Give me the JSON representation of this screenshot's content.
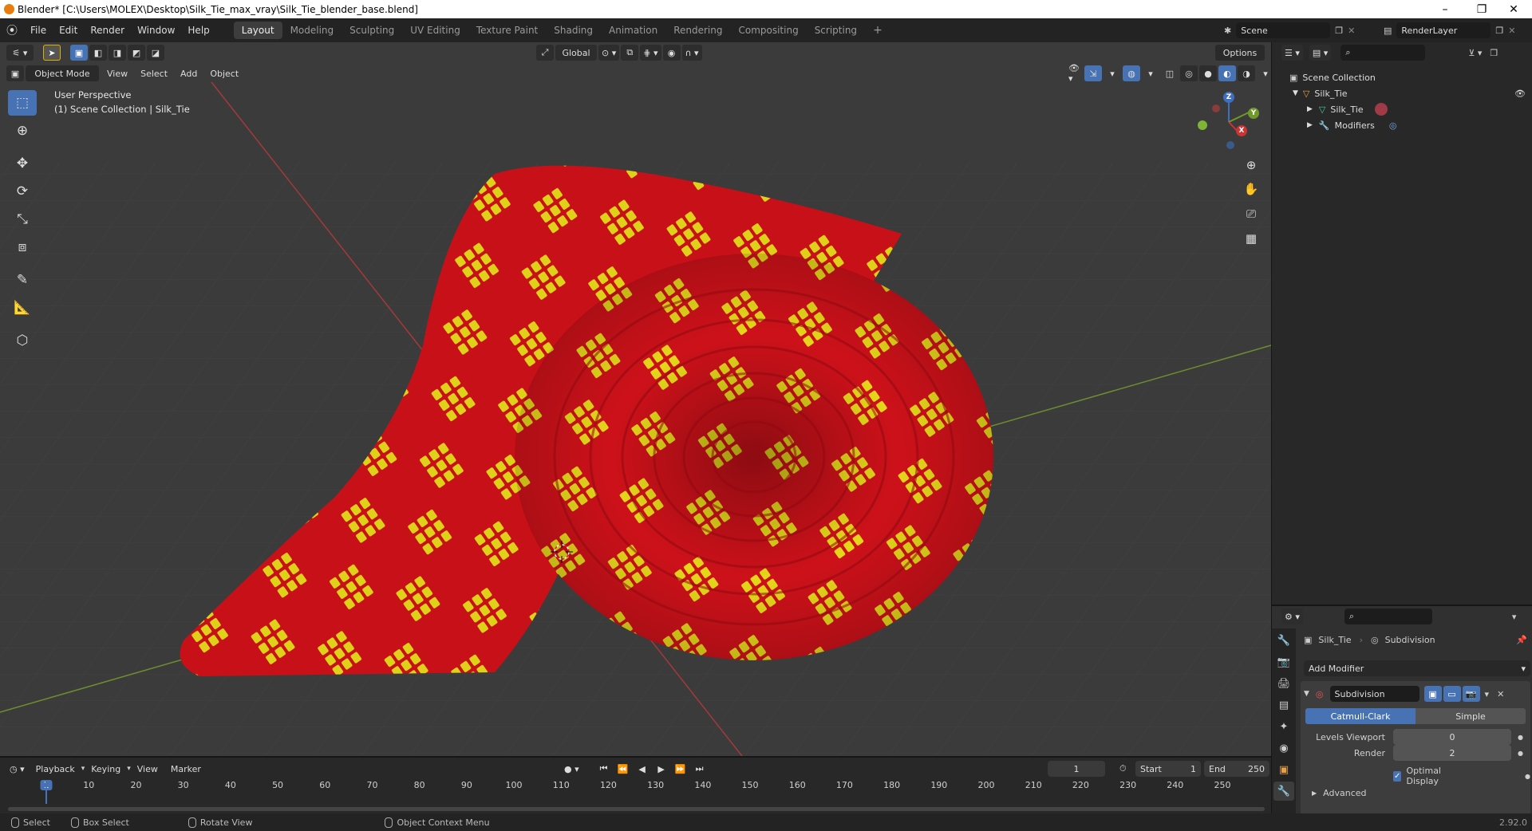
{
  "window": {
    "title": "Blender* [C:\\Users\\MOLEX\\Desktop\\Silk_Tie_max_vray\\Silk_Tie_blender_base.blend]",
    "minimize": "–",
    "restore": "❐",
    "close": "✕"
  },
  "menu": [
    "File",
    "Edit",
    "Render",
    "Window",
    "Help"
  ],
  "workspaces": [
    "Layout",
    "Modeling",
    "Sculpting",
    "UV Editing",
    "Texture Paint",
    "Shading",
    "Animation",
    "Rendering",
    "Compositing",
    "Scripting"
  ],
  "active_workspace": "Layout",
  "scene": {
    "label": "Scene",
    "render_layer": "RenderLayer"
  },
  "header3d": {
    "mode": "Object Mode",
    "menus": [
      "View",
      "Select",
      "Add",
      "Object"
    ],
    "transform_orientation": "Global",
    "options": "Options"
  },
  "viewport": {
    "perspective": "User Perspective",
    "collection": "(1) Scene Collection | Silk_Tie",
    "gizmo": {
      "x": "X",
      "y": "Y",
      "z": "Z"
    }
  },
  "outliner": {
    "root": "Scene Collection",
    "items": [
      {
        "label": "Silk_Tie",
        "depth": 1
      },
      {
        "label": "Silk_Tie",
        "depth": 2
      },
      {
        "label": "Modifiers",
        "depth": 2
      }
    ]
  },
  "properties": {
    "object": "Silk_Tie",
    "modifier_breadcrumb": "Subdivision",
    "add_modifier": "Add Modifier",
    "modifier": {
      "name": "Subdivision",
      "type_active": "Catmull-Clark",
      "type_other": "Simple",
      "levels_viewport_label": "Levels Viewport",
      "levels_viewport": "0",
      "render_label": "Render",
      "render": "2",
      "optimal_display": "Optimal Display",
      "advanced": "Advanced"
    }
  },
  "timeline": {
    "menus": [
      "Playback",
      "Keying",
      "View",
      "Marker"
    ],
    "current_frame": "1",
    "start_label": "Start",
    "start": "1",
    "end_label": "End",
    "end": "250",
    "ticks": [
      "1",
      "10",
      "20",
      "30",
      "40",
      "50",
      "60",
      "70",
      "80",
      "90",
      "100",
      "110",
      "120",
      "130",
      "140",
      "150",
      "160",
      "170",
      "180",
      "190",
      "200",
      "210",
      "220",
      "230",
      "240",
      "250"
    ]
  },
  "statusbar": {
    "select": "Select",
    "box_select": "Box Select",
    "rotate_view": "Rotate View",
    "context_menu": "Object Context Menu",
    "version": "2.92.0"
  },
  "colors": {
    "accent": "#4772b3",
    "tie_red": "#d8121b",
    "tie_pattern": "#f2e21c",
    "viewport_bg": "#3b3b3b"
  }
}
